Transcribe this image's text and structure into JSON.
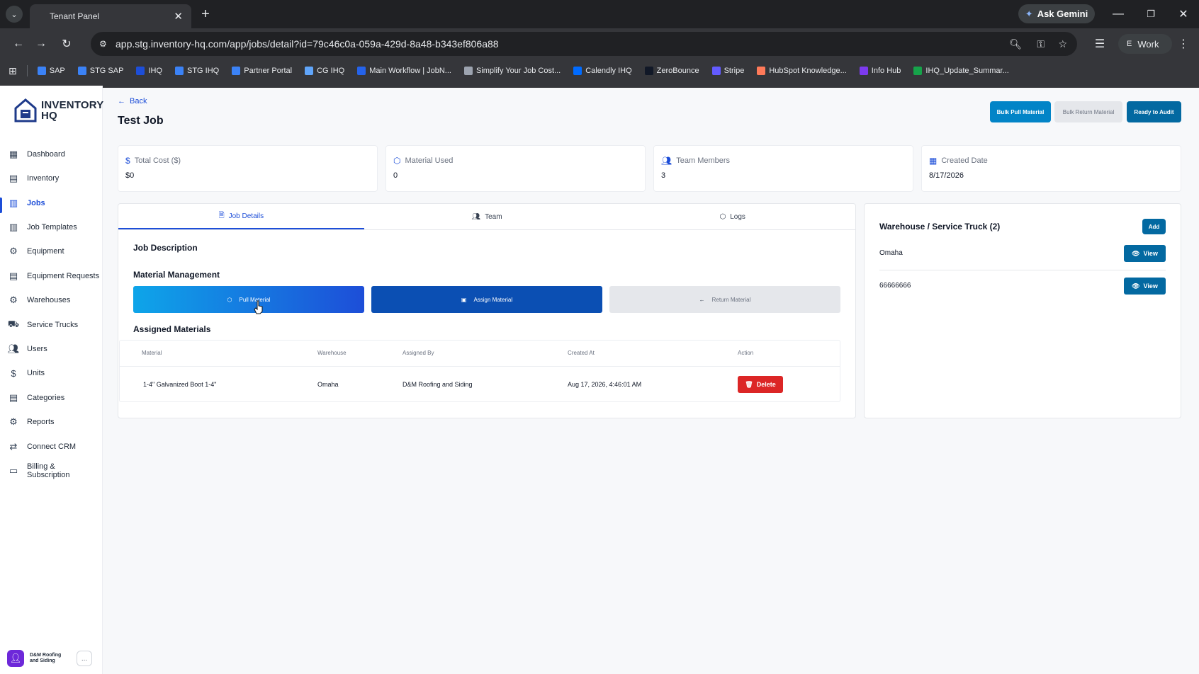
{
  "browser": {
    "tab_title": "Tenant Panel",
    "url": "app.stg.inventory-hq.com/app/jobs/detail?id=79c46c0a-059a-429d-8a48-b343ef806a88",
    "gemini_label": "Ask Gemini",
    "profile_initial": "E",
    "profile_label": "Work",
    "bookmarks": [
      {
        "label": "SAP",
        "color": "#3b82f6"
      },
      {
        "label": "STG SAP",
        "color": "#3b82f6"
      },
      {
        "label": "IHQ",
        "color": "#1d4ed8"
      },
      {
        "label": "STG IHQ",
        "color": "#3b82f6"
      },
      {
        "label": "Partner Portal",
        "color": "#3b82f6"
      },
      {
        "label": "CG IHQ",
        "color": "#60a5fa"
      },
      {
        "label": "Main Workflow | JobN...",
        "color": "#2563eb"
      },
      {
        "label": "Simplify Your Job Cost...",
        "color": "#9ca3af"
      },
      {
        "label": "Calendly IHQ",
        "color": "#006bff"
      },
      {
        "label": "ZeroBounce",
        "color": "#111827"
      },
      {
        "label": "Stripe",
        "color": "#635bff"
      },
      {
        "label": "HubSpot Knowledge...",
        "color": "#ff7a59"
      },
      {
        "label": "Info Hub",
        "color": "#7c3aed"
      },
      {
        "label": "IHQ_Update_Summar...",
        "color": "#16a34a"
      }
    ]
  },
  "app": {
    "logo_line1": "INVENTORY",
    "logo_line2": "HQ"
  },
  "sidebar": {
    "items": [
      {
        "label": "Dashboard",
        "icon": "grid-icon"
      },
      {
        "label": "Inventory",
        "icon": "boxes-icon"
      },
      {
        "label": "Jobs",
        "icon": "jobs-icon",
        "active": true
      },
      {
        "label": "Job Templates",
        "icon": "templates-icon"
      },
      {
        "label": "Equipment",
        "icon": "equipment-icon"
      },
      {
        "label": "Equipment Requests",
        "icon": "requests-icon"
      },
      {
        "label": "Warehouses",
        "icon": "warehouse-icon"
      },
      {
        "label": "Service Trucks",
        "icon": "truck-icon"
      },
      {
        "label": "Users",
        "icon": "users-icon"
      },
      {
        "label": "Units",
        "icon": "units-icon"
      },
      {
        "label": "Categories",
        "icon": "categories-icon"
      },
      {
        "label": "Reports",
        "icon": "reports-icon"
      },
      {
        "label": "Connect CRM",
        "icon": "crm-icon"
      },
      {
        "label": "Billing & Subscription",
        "icon": "billing-icon"
      }
    ],
    "user_name": "D&M Roofing and Siding",
    "more_label": "..."
  },
  "header": {
    "back_label": "Back",
    "title": "Test Job",
    "bulk_pull_label": "Bulk Pull Material",
    "bulk_return_label": "Bulk Return Material",
    "ready_audit_label": "Ready to Audit"
  },
  "stats": [
    {
      "label": "Total Cost ($)",
      "value": "$0",
      "icon": "dollar-icon"
    },
    {
      "label": "Material Used",
      "value": "0",
      "icon": "box-icon"
    },
    {
      "label": "Team Members",
      "value": "3",
      "icon": "team-icon"
    },
    {
      "label": "Created Date",
      "value": "8/17/2026",
      "icon": "calendar-icon"
    }
  ],
  "tabs": [
    {
      "label": "Job Details",
      "active": true
    },
    {
      "label": "Team"
    },
    {
      "label": "Logs"
    }
  ],
  "details": {
    "job_description_heading": "Job Description",
    "material_management_heading": "Material Management",
    "pull_label": "Pull Material",
    "assign_label": "Assign Material",
    "return_label": "Return Material",
    "assigned_heading": "Assigned Materials",
    "columns": [
      "Material",
      "Warehouse",
      "Assigned By",
      "Created At",
      "Action"
    ],
    "rows": [
      {
        "material": "1-4\" Galvanized Boot 1-4\"",
        "warehouse": "Omaha",
        "assigned_by": "D&M Roofing and Siding",
        "created_at": "Aug 17, 2026, 4:46:01 AM",
        "action": "Delete"
      }
    ]
  },
  "warehouse_panel": {
    "title": "Warehouse / Service Truck (2)",
    "add_label": "Add",
    "items": [
      {
        "name": "Omaha",
        "action": "View"
      },
      {
        "name": "66666666",
        "action": "View"
      }
    ]
  },
  "colors": {
    "accent": "#1d4ed8",
    "pull_gradient_start": "#0ea5e9",
    "pull_gradient_end": "#1d4ed8",
    "danger": "#dc2626",
    "view_button": "#0369a1"
  }
}
